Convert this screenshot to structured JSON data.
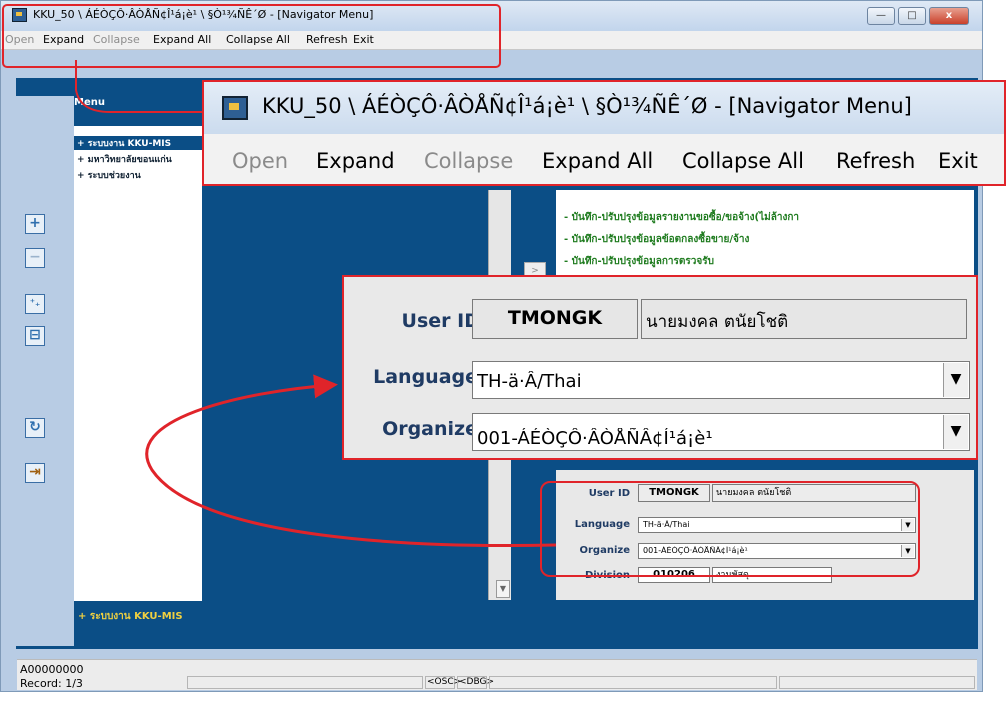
{
  "window": {
    "title": "KKU_50 \\ ÁÉÒÇÔ·ÂÒÅÑ¢Î¹á¡è¹ \\ §Ò¹¾ÑÊ´Ø - [Navigator Menu]",
    "minimize_glyph": "—",
    "maximize_glyph": "□",
    "close_glyph": "x"
  },
  "menubar": {
    "items": [
      "Open",
      "Expand",
      "Collapse",
      "Expand All",
      "Collapse All",
      "Refresh",
      "Exit"
    ]
  },
  "menu_panel": {
    "header": "Menu",
    "tree": [
      "+ ระบบงาน KKU-MIS",
      "+ มหาวิทยาลัยขอนแก่น",
      "+ ระบบช่วยงาน"
    ]
  },
  "toolbar_icons": [
    "expand-icon",
    "collapse-icon",
    "expand-all-icon",
    "collapse-all-icon",
    "refresh-icon",
    "exit-icon"
  ],
  "toolbar_glyphs": [
    "+",
    "−",
    "⁺₊",
    "⊟",
    "↻",
    "⇥"
  ],
  "actions": {
    "items": [
      "- บันทึก-ปรับปรุงข้อมูลรายงานขอซื้อ/ขอจ้าง(ไม่ล้างกา",
      "- บันทึก-ปรับปรุงข้อมูลข้อตกลงซื้อขาย/จ้าง",
      "- บันทึก-ปรับปรุงข้อมูลการตรวจรับ"
    ],
    "move_glyph": ">"
  },
  "login": {
    "user_id_label": "User ID",
    "user_id": "TMONGK",
    "user_name": "นายมงคล  ตนัยโชติ",
    "language_label": "Language",
    "language": "TH-ä·Â/Thai",
    "organize_label": "Organize",
    "organize": "001-ÁÉÒÇÔ·ÂÒÅÑÂ¢Í¹á¡è¹",
    "division_label": "Division",
    "division_code": "010206",
    "division_name": "งานพัสดุ",
    "dropdown_glyph": "▼"
  },
  "bottom_bar": {
    "text": "+ ระบบงาน KKU-MIS"
  },
  "status": {
    "code": "A00000000",
    "record": "Record: 1/3",
    "osc": "<OSC>",
    "dbg": "<DBG>"
  },
  "colors": {
    "frame_blue": "#0b4e86",
    "callout_red": "#e0242a",
    "action_green": "#1e7b1e"
  }
}
